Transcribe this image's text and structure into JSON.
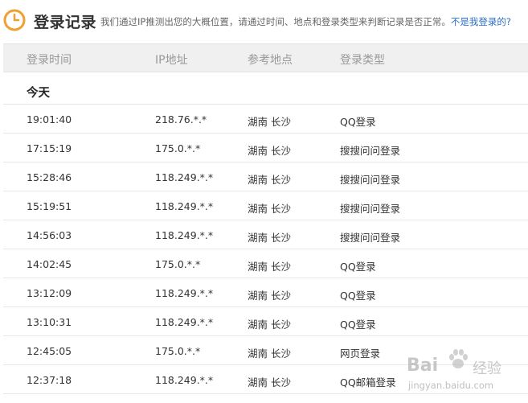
{
  "header": {
    "title": "登录记录",
    "description": "我们通过IP推测出您的大概位置，请通过时间、地点和登录类型来判断记录是否正常。",
    "link_text": "不是我登录的?"
  },
  "columns": [
    "登录时间",
    "IP地址",
    "参考地点",
    "登录类型"
  ],
  "group_label": "今天",
  "rows": [
    {
      "time": "19:01:40",
      "ip": "218.76.*.*",
      "location": "湖南  长沙",
      "type": "QQ登录"
    },
    {
      "time": "17:15:19",
      "ip": "175.0.*.*",
      "location": "湖南  长沙",
      "type": "搜搜问问登录"
    },
    {
      "time": "15:28:46",
      "ip": "118.249.*.*",
      "location": "湖南  长沙",
      "type": "搜搜问问登录"
    },
    {
      "time": "15:19:51",
      "ip": "118.249.*.*",
      "location": "湖南  长沙",
      "type": "搜搜问问登录"
    },
    {
      "time": "14:56:03",
      "ip": "118.249.*.*",
      "location": "湖南  长沙",
      "type": "搜搜问问登录"
    },
    {
      "time": "14:02:45",
      "ip": "175.0.*.*",
      "location": "湖南  长沙",
      "type": "QQ登录"
    },
    {
      "time": "13:12:09",
      "ip": "118.249.*.*",
      "location": "湖南  长沙",
      "type": "QQ登录"
    },
    {
      "time": "13:10:31",
      "ip": "118.249.*.*",
      "location": "湖南  长沙",
      "type": "QQ登录"
    },
    {
      "time": "12:45:05",
      "ip": "175.0.*.*",
      "location": "湖南  长沙",
      "type": "网页登录"
    },
    {
      "time": "12:37:18",
      "ip": "118.249.*.*",
      "location": "湖南  长沙",
      "type": "QQ邮箱登录"
    }
  ],
  "watermark": {
    "brand": "Bai",
    "brand_suffix": "经验",
    "url": "jingyan.baidu.com"
  },
  "colors": {
    "accent": "#f0a030",
    "link": "#2b6fc2",
    "header_bg": "#f0f0f0"
  },
  "icons": {
    "header": "clock-icon",
    "watermark": "paw-icon"
  }
}
